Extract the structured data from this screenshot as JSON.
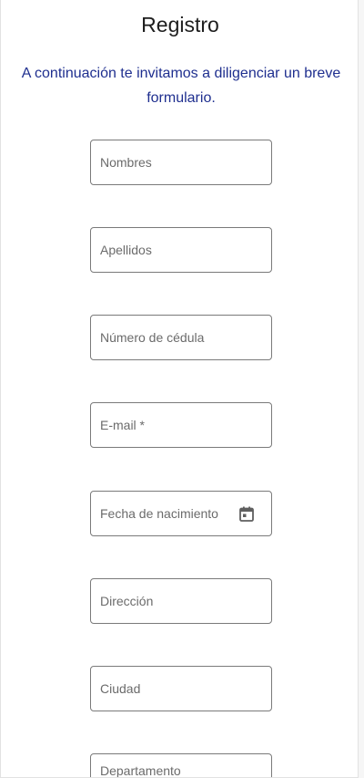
{
  "header": {
    "title": "Registro",
    "intro": "A continuación te invitamos a diligenciar un breve formulario."
  },
  "form": {
    "fields": [
      {
        "name": "nombres-field",
        "label": "Nombres"
      },
      {
        "name": "apellidos-field",
        "label": "Apellidos"
      },
      {
        "name": "cedula-field",
        "label": "Número de cédula"
      },
      {
        "name": "email-field",
        "label": "E-mail *"
      },
      {
        "name": "birthdate-field",
        "label": "Fecha de nacimiento",
        "icon": "calendar-icon"
      },
      {
        "name": "direccion-field",
        "label": "Dirección"
      },
      {
        "name": "ciudad-field",
        "label": "Ciudad"
      },
      {
        "name": "departamento-field",
        "label": "Departamento"
      }
    ]
  }
}
